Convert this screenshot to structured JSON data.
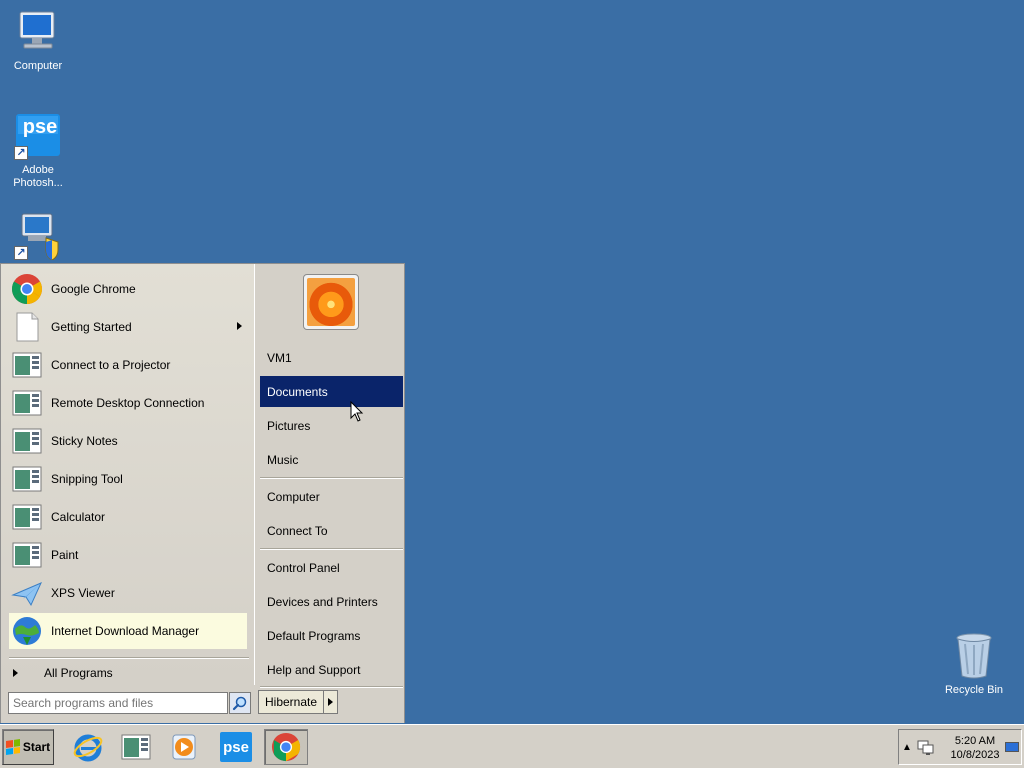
{
  "desktop": {
    "icons": [
      {
        "label": "Computer"
      },
      {
        "label": "Adobe Photosh...",
        "badge": "pse"
      },
      {
        "label": ""
      },
      {
        "label": "Recycle Bin"
      }
    ]
  },
  "start_menu": {
    "programs": [
      {
        "label": "Google Chrome",
        "icon": "chrome-icon"
      },
      {
        "label": "Getting Started",
        "icon": "document-icon",
        "submenu": true
      },
      {
        "label": "Connect to a Projector",
        "icon": "app-window-icon"
      },
      {
        "label": "Remote Desktop Connection",
        "icon": "app-window-icon"
      },
      {
        "label": "Sticky Notes",
        "icon": "app-window-icon"
      },
      {
        "label": "Snipping Tool",
        "icon": "app-window-icon"
      },
      {
        "label": "Calculator",
        "icon": "app-window-icon"
      },
      {
        "label": "Paint",
        "icon": "app-window-icon"
      },
      {
        "label": "XPS Viewer",
        "icon": "paper-plane-icon"
      },
      {
        "label": "Internet Download Manager",
        "icon": "globe-download-icon",
        "highlighted": true
      }
    ],
    "all_programs_label": "All Programs",
    "search_placeholder": "Search programs and files",
    "places_group1": [
      "VM1",
      "Documents",
      "Pictures",
      "Music"
    ],
    "places_group2": [
      "Computer",
      "Connect To"
    ],
    "places_group3": [
      "Control Panel",
      "Devices and Printers",
      "Default Programs",
      "Help and Support"
    ],
    "active_place": "Documents",
    "power_button_label": "Hibernate"
  },
  "taskbar": {
    "start_label": "Start",
    "pinned": [
      "internet-explorer-icon",
      "app-window-icon",
      "media-player-icon",
      "photoshop-elements-icon",
      "chrome-icon"
    ],
    "photoshop_badge": "pse",
    "clock_time": "5:20 AM",
    "clock_date": "10/8/2023"
  },
  "colors": {
    "desktop_bg": "#3a6ea5",
    "selection": "#0a246a",
    "highlight_item": "#fbfbdf"
  }
}
